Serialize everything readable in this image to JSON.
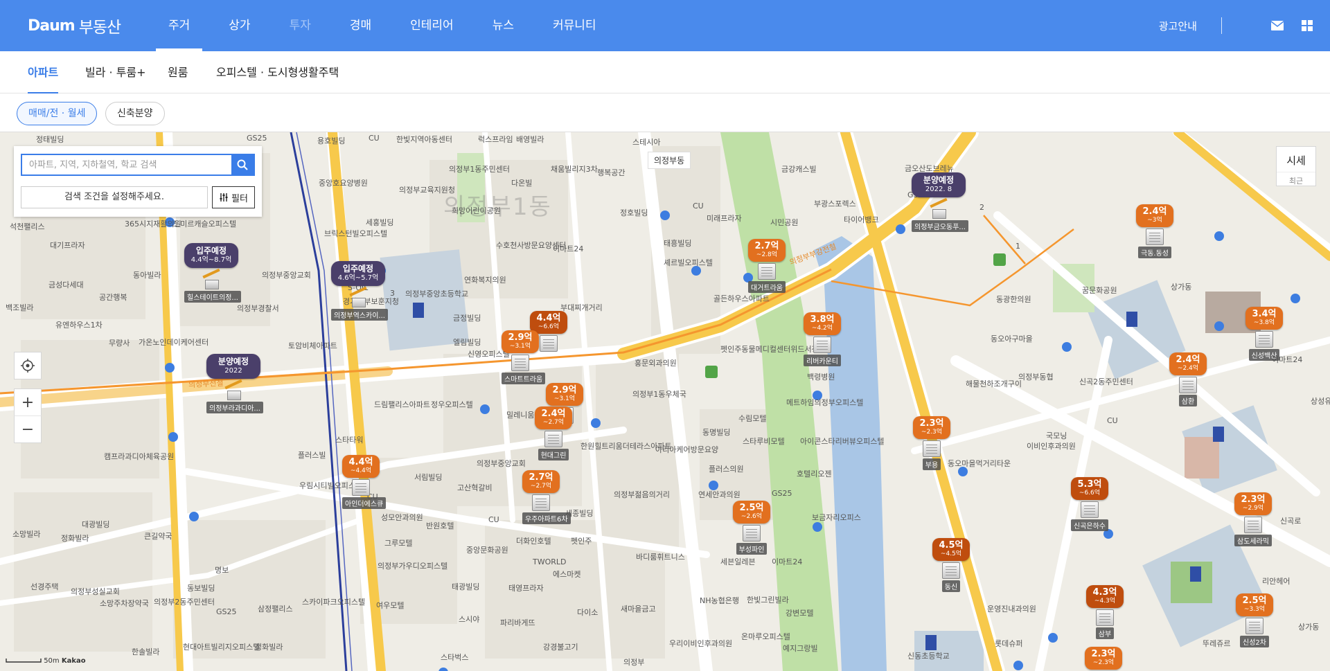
{
  "header": {
    "logo_brand": "Daum",
    "logo_service": "부동산",
    "nav": [
      {
        "label": "주거",
        "state": "active"
      },
      {
        "label": "상가",
        "state": ""
      },
      {
        "label": "투자",
        "state": "dim"
      },
      {
        "label": "경매",
        "state": ""
      },
      {
        "label": "인테리어",
        "state": ""
      },
      {
        "label": "뉴스",
        "state": ""
      },
      {
        "label": "커뮤니티",
        "state": ""
      }
    ],
    "ad_link": "광고안내",
    "icons": [
      "mail-icon",
      "grid-icon"
    ]
  },
  "subnav": {
    "tabs": [
      "아파트",
      "빌라 · 투룸+",
      "원룸",
      "오피스텔 · 도시형생활주택"
    ],
    "active_index": 0
  },
  "filters": {
    "pills": [
      "매매/전 · 월세",
      "신축분양"
    ],
    "active_index": 0
  },
  "search": {
    "placeholder": "아파트, 지역, 지하철역, 학교 검색",
    "value": "",
    "condition_text": "검색 조건을 설정해주세요.",
    "filter_label": "필터"
  },
  "map_controls": {
    "sise_label": "시세",
    "sise_sub": "최근",
    "zoom_in": "+",
    "zoom_out": "−",
    "scale_label": "50m",
    "scale_brand": "Kakao",
    "district_label": "의정부1동"
  },
  "price_markers": [
    {
      "price": "4.4억",
      "range": "~6.6억",
      "name": "",
      "dark": true
    },
    {
      "price": "2.9억",
      "range": "~3.1억",
      "name": "스마트트라움",
      "dark": false
    },
    {
      "price": "2.9억",
      "range": "~3.1억",
      "name": "",
      "dark": false
    },
    {
      "price": "2.4억",
      "range": "~2.7억",
      "name": "현대그린",
      "dark": false
    },
    {
      "price": "2.7억",
      "range": "~2.7억",
      "name": "우주아파트6차",
      "dark": false
    },
    {
      "price": "4.4억",
      "range": "~4.4억",
      "name": "아인더에스큐",
      "dark": false
    },
    {
      "price": "2.7억",
      "range": "~2.8억",
      "name": "대거트라움",
      "dark": false
    },
    {
      "price": "3.8억",
      "range": "~4.2억",
      "name": "리버카운티",
      "dark": false
    },
    {
      "price": "2.5억",
      "range": "~2.6억",
      "name": "부성파인",
      "dark": false
    },
    {
      "price": "2.3억",
      "range": "~2.3억",
      "name": "부용",
      "dark": false
    },
    {
      "price": "4.5억",
      "range": "~4.5억",
      "name": "동신",
      "dark": true
    },
    {
      "price": "2.4억",
      "range": "~3억",
      "name": "극동.동성",
      "dark": false
    },
    {
      "price": "2.4억",
      "range": "~2.4억",
      "name": "삼환",
      "dark": false
    },
    {
      "price": "3.4억",
      "range": "~3.8억",
      "name": "신성백산",
      "dark": false
    },
    {
      "price": "5.3억",
      "range": "~6.6억",
      "name": "신곡은하수",
      "dark": true
    },
    {
      "price": "2.3억",
      "range": "~2.9억",
      "name": "삼도세라믹",
      "dark": false
    },
    {
      "price": "4.3억",
      "range": "~4.3억",
      "name": "삼부",
      "dark": true
    },
    {
      "price": "2.5억",
      "range": "~3.3억",
      "name": "신성2차",
      "dark": false
    },
    {
      "price": "2.3억",
      "range": "~2.3억",
      "name": "",
      "dark": false
    }
  ],
  "upcoming_markers": [
    {
      "title": "입주예정",
      "sub": "4.4억~8.7억",
      "name": "힐스테이트의정..."
    },
    {
      "title": "입주예정",
      "sub": "4.6억~5.7억",
      "name": "의정부역스카이..."
    },
    {
      "title": "분양예정",
      "sub": "2022",
      "name": "의정부라과디아..."
    },
    {
      "title": "분양예정",
      "sub": "2022. 8",
      "name": "의정부금오동푸..."
    }
  ],
  "map_labels": [
    "정태빌딩",
    "GS25",
    "용호빌딩",
    "한빛지역아동센터",
    "럭스프라임",
    "배영빌라",
    "스테시아",
    "의정부동",
    "금강캐스빌",
    "중앙호요양병원",
    "의정부교육지원청",
    "의정부1동주민센터",
    "다온빌",
    "채움빌리지3차",
    "행복공간",
    "부광스포렉스",
    "타이어뱅크",
    "석천팰리스",
    "365시지재활의원",
    "드미르캐슬오피스텔",
    "세홍빌딩",
    "희망어린이공원",
    "수호천사방문요양센터",
    "이마트24",
    "정호빌딩",
    "미래프라자",
    "시민공원",
    "대기프라자",
    "동아빌라",
    "의정부중앙교회",
    "브릭스턴빌오피스텔",
    "의정부중앙초등학교",
    "연화복지의원",
    "태흥빌딩",
    "셰르빌오피스텔",
    "골든하우스아파트",
    "금성다세대",
    "공간행복",
    "S-OIL",
    "경기북부보훈지청",
    "금정빌딩",
    "부대찌개거리",
    "동광한의원",
    "꿈문화공원",
    "상가동",
    "백조빌라",
    "유엔하우스1차",
    "가온노인데이케어센터",
    "의정부경찰서",
    "엘림빌딩",
    "신영오피스텔",
    "홍문외과의원",
    "펫인주동물메디컬센터위드서정",
    "동오아구마을",
    "무량사",
    "토암비체아파트",
    "의정부동협",
    "신곡2동주민센터",
    "해물천하조개구이",
    "이마트24",
    "정우오피스텔",
    "드림팰리스아파트",
    "밀레니움오피스텔",
    "의정부1동우체국",
    "백령병원",
    "메트하임의정부오피스텔",
    "상성유치원",
    "캠프라과디아체육공원",
    "스타타워",
    "플러스빌",
    "의정부중앙교회",
    "동명빌딩",
    "수림모텔",
    "스타루비모텔",
    "아이콘스타리버뷰오피스텔",
    "국모닝",
    "이비인후과의원",
    "우림시티빌오피스텔",
    "서림빌딩",
    "고산혁갈비",
    "한원힐트리움더테라스아파트",
    "아리아케어방문요양",
    "플러스의원",
    "호텔리오젠",
    "소망빌라",
    "대광빌딩",
    "정화빌라",
    "큰길약국",
    "성모안과의원",
    "반원호텔",
    "세종빌딩",
    "의정부젊음의거리",
    "연세안과의원",
    "GS25",
    "보금자리오피스",
    "신곡로",
    "동오마을먹거리타운",
    "명보",
    "의정부성실교회",
    "그루모텔",
    "의정부가우디오피스텔",
    "더화인호텔",
    "중앙문화공원",
    "펫인주",
    "TWORLD",
    "에스마켓",
    "바디룸휘트니스",
    "세븐일레븐",
    "이마트24",
    "선경주택",
    "소망주차장약국",
    "의정부2동주민센터",
    "동보빌딩",
    "스카이파크오피스텔",
    "삼정팰리스",
    "여우모텔",
    "태광빌딩",
    "태영프라자",
    "다이소",
    "새마을금고",
    "NH농협은행",
    "한빛그린빌라",
    "강변모텔",
    "운영진내과의원",
    "리안헤어",
    "GS25",
    "한솔빌라",
    "현대아트빌리지오피스텔",
    "정화빌라",
    "스시야",
    "파리바게뜨",
    "강경불고기",
    "우리이비인후과의원",
    "온마루오피스텔",
    "예지그랑빌",
    "롯데슈퍼",
    "뚜레쥬르",
    "상가동",
    "스타벅스",
    "의정부",
    "신동초등학교",
    "금오산도브레뉴",
    "GS25",
    "의정부부강전철",
    "의정부전철",
    "2",
    "1",
    "3",
    "CU",
    "CU",
    "CU",
    "CU",
    "CU"
  ]
}
